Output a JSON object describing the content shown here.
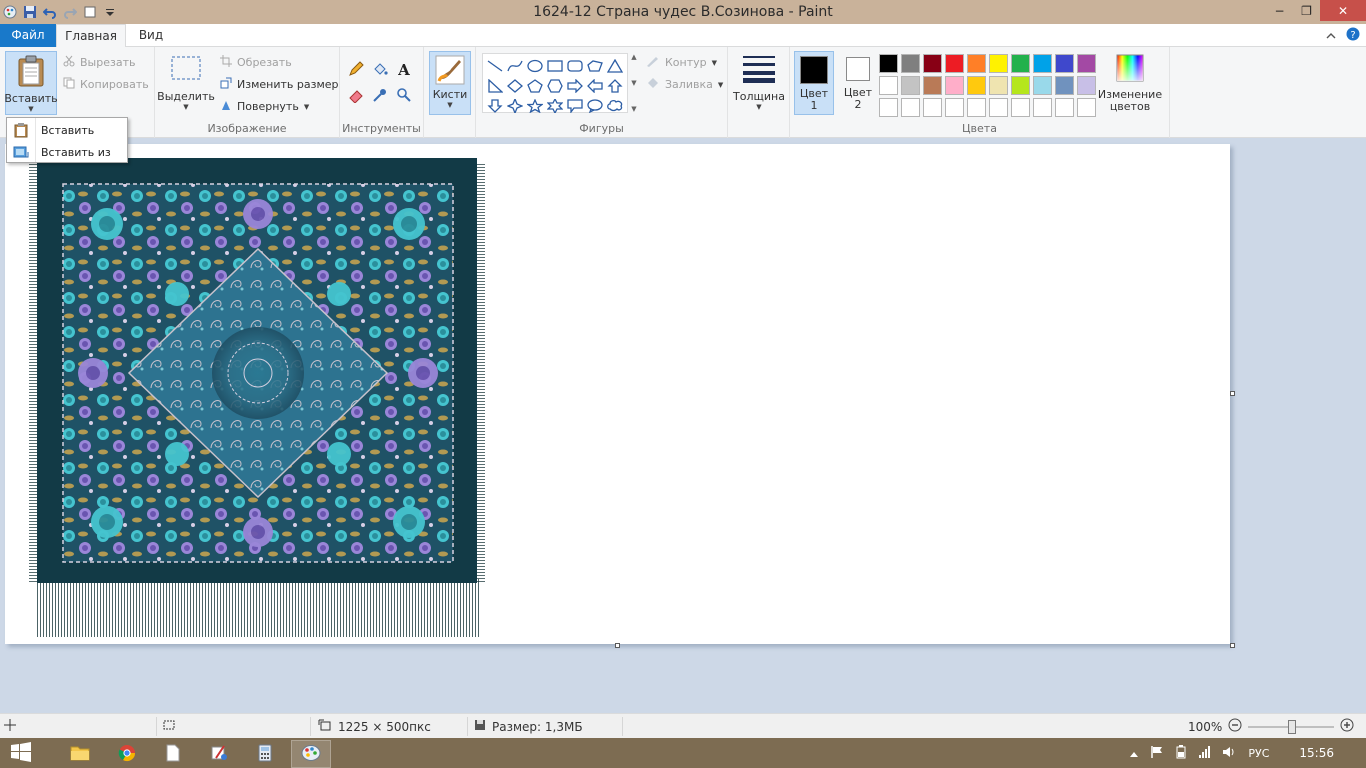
{
  "window": {
    "title": "1624-12 Страна чудес В.Созинова - Paint",
    "min_label": "−",
    "max_label": "❐",
    "close_label": "✕"
  },
  "tabs": {
    "file": "Файл",
    "home": "Главная",
    "view": "Вид"
  },
  "ribbon": {
    "clipboard": {
      "paste": "Вставить",
      "cut": "Вырезать",
      "copy": "Копировать"
    },
    "image": {
      "select": "Выделить",
      "crop": "Обрезать",
      "resize": "Изменить размер",
      "rotate": "Повернуть",
      "group_label": "Изображение"
    },
    "tools": {
      "group_label": "Инструменты"
    },
    "brushes": {
      "label": "Кисти"
    },
    "shapes": {
      "outline": "Контур",
      "fill": "Заливка",
      "group_label": "Фигуры"
    },
    "size": {
      "label": "Толщина"
    },
    "colors": {
      "color1_line1": "Цвет",
      "color1_line2": "1",
      "color2_line1": "Цвет",
      "color2_line2": "2",
      "edit_line1": "Изменение",
      "edit_line2": "цветов",
      "group_label": "Цвета",
      "color1": "#000000",
      "color2": "#ffffff",
      "palette": [
        "#000000",
        "#7f7f7f",
        "#880015",
        "#ed1c24",
        "#ff7f27",
        "#fff200",
        "#22b14c",
        "#00a2e8",
        "#3f48cc",
        "#a349a4",
        "#ffffff",
        "#c3c3c3",
        "#b97a57",
        "#ffaec9",
        "#ffc90e",
        "#efe4b0",
        "#b5e61d",
        "#99d9ea",
        "#7092be",
        "#c8bfe7",
        "#ffffff",
        "#ffffff",
        "#ffffff",
        "#ffffff",
        "#ffffff",
        "#ffffff",
        "#ffffff",
        "#ffffff",
        "#ffffff",
        "#ffffff"
      ]
    }
  },
  "paste_menu": {
    "paste": "Вставить",
    "paste_from": "Вставить из"
  },
  "status": {
    "dimensions": "1225 × 500пкс",
    "size": "Размер: 1,3МБ",
    "zoom": "100%"
  },
  "taskbar": {
    "lang": "РУС",
    "time": "15:56"
  },
  "icons": {
    "start": "windows-logo-icon",
    "explorer": "folder-icon",
    "chrome": "chrome-icon",
    "doc": "document-icon",
    "paint_app": "paint-app-icon",
    "calc": "calculator-icon"
  }
}
